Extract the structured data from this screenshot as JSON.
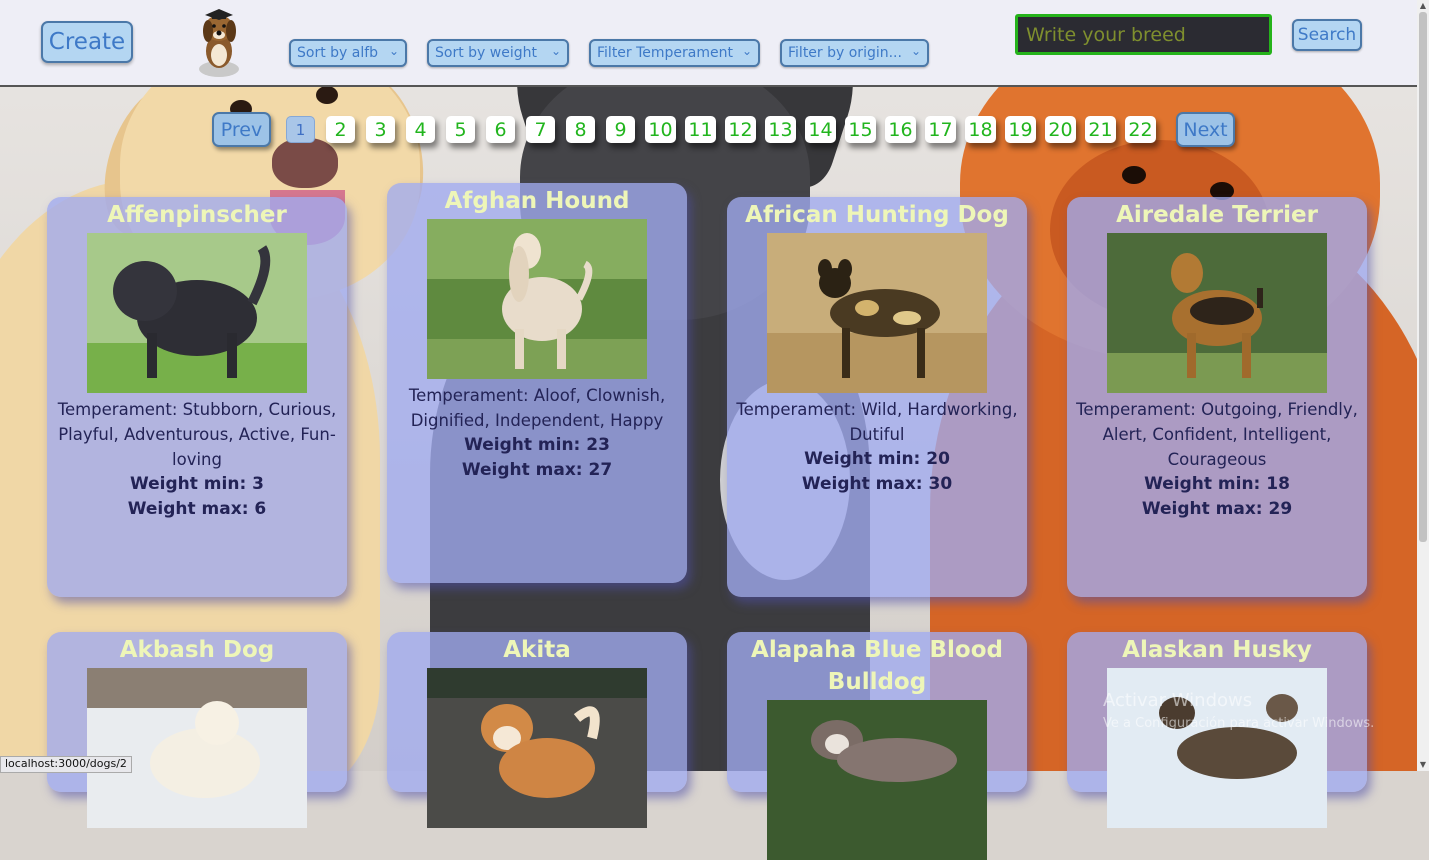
{
  "header": {
    "create_label": "Create",
    "sort_alpha": "Sort by alfb",
    "sort_weight": "Sort by weight",
    "filter_temperament": "Filter Temperament",
    "filter_origin": "Filter by origin...",
    "search_placeholder": "Write your breed",
    "search_label": "Search"
  },
  "pagination": {
    "prev_label": "Prev",
    "next_label": "Next",
    "current": "1",
    "pages": [
      "1",
      "2",
      "3",
      "4",
      "5",
      "6",
      "7",
      "8",
      "9",
      "10",
      "11",
      "12",
      "13",
      "14",
      "15",
      "16",
      "17",
      "18",
      "19",
      "20",
      "21",
      "22"
    ]
  },
  "cards": [
    {
      "name": "Affenpinscher",
      "temperament": "Temperament: Stubborn, Curious, Playful, Adventurous, Active, Fun-loving",
      "weight_min": "Weight min: 3",
      "weight_max": "Weight max: 6"
    },
    {
      "name": "Afghan Hound",
      "temperament": "Temperament: Aloof, Clownish, Dignified, Independent, Happy",
      "weight_min": "Weight min: 23",
      "weight_max": "Weight max: 27"
    },
    {
      "name": "African Hunting Dog",
      "temperament": "Temperament: Wild, Hardworking, Dutiful",
      "weight_min": "Weight min: 20",
      "weight_max": "Weight max: 30"
    },
    {
      "name": "Airedale Terrier",
      "temperament": "Temperament: Outgoing, Friendly, Alert, Confident, Intelligent, Courageous",
      "weight_min": "Weight min: 18",
      "weight_max": "Weight max: 29"
    },
    {
      "name": "Akbash Dog"
    },
    {
      "name": "Akita"
    },
    {
      "name": "Alapaha Blue Blood Bulldog"
    },
    {
      "name": "Alaskan Husky"
    }
  ],
  "status_url": "localhost:3000/dogs/2",
  "watermark": {
    "title": "Activar Windows",
    "subtitle": "Ve a Configuración para activar Windows."
  }
}
